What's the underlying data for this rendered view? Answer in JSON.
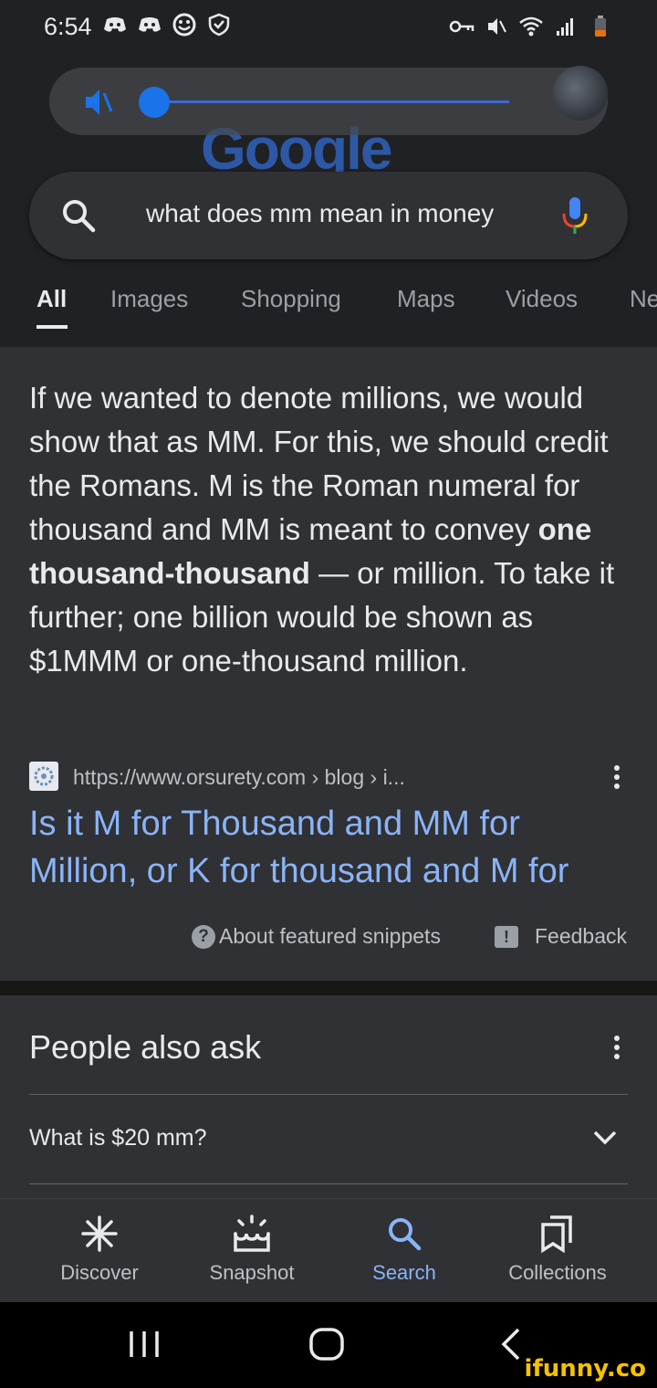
{
  "status_bar": {
    "time": "6:54",
    "left_icons": [
      "discord-icon",
      "discord-icon",
      "smiley-icon",
      "shield-icon"
    ],
    "right_icons": [
      "vpn-key-icon",
      "mute-icon",
      "wifi-icon",
      "signal-icon",
      "battery-low-icon"
    ],
    "battery_color": "#e8710a"
  },
  "volume_overlay": {
    "icon": "mute-icon",
    "level": 0,
    "accent": "#1a73e8",
    "expand_icon": "chevron-down-icon"
  },
  "header": {
    "logo_text": "Google",
    "search": {
      "query": "what does mm mean in money",
      "search_icon": "search-icon",
      "mic_icon": "mic-icon"
    },
    "tabs": [
      {
        "label": "All",
        "active": true
      },
      {
        "label": "Images",
        "active": false
      },
      {
        "label": "Shopping",
        "active": false
      },
      {
        "label": "Maps",
        "active": false
      },
      {
        "label": "Videos",
        "active": false
      },
      {
        "label": "News",
        "active": false
      }
    ]
  },
  "featured_snippet": {
    "text_before": "If we wanted to denote millions, we would show that as MM. For this, we should credit the Romans. M is the Roman numeral for thousand and MM is meant to convey ",
    "text_bold": "one thousand-thousand",
    "text_after": " — or million. To take it further; one billion would be shown as $1MMM or one-thousand million.",
    "source_url": "https://www.orsurety.com › blog › i...",
    "title": "Is it M for Thousand and MM for Million, or K for thousand and M for",
    "about_label": "About featured snippets",
    "feedback_label": "Feedback"
  },
  "people_also_ask": {
    "title": "People also ask",
    "questions": [
      "What is $20 mm?"
    ]
  },
  "bottom_nav": {
    "items": [
      {
        "label": "Discover",
        "icon": "asterisk-icon",
        "active": false
      },
      {
        "label": "Snapshot",
        "icon": "snapshot-icon",
        "active": false
      },
      {
        "label": "Search",
        "icon": "search-icon",
        "active": true
      },
      {
        "label": "Collections",
        "icon": "collections-icon",
        "active": false
      }
    ],
    "active_color": "#8ab4f8"
  },
  "system_nav": {
    "buttons": [
      "recents-icon",
      "home-icon",
      "back-icon"
    ]
  },
  "watermark": "ifunny.co"
}
